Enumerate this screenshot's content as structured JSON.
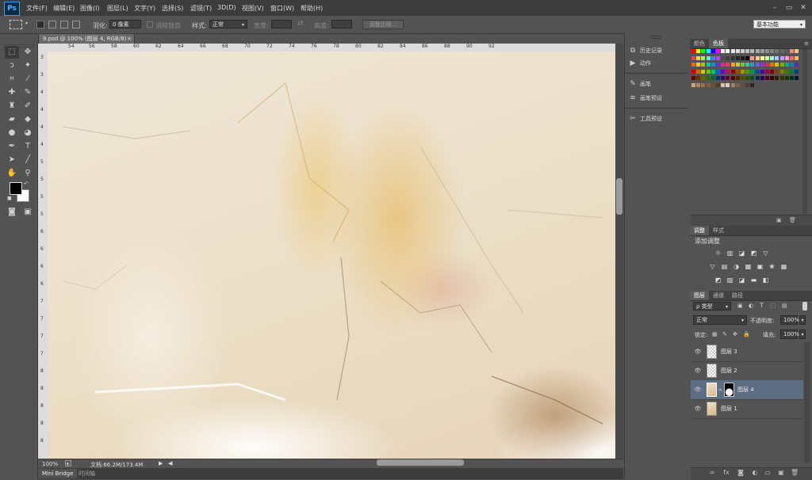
{
  "app": {
    "logo": "Ps"
  },
  "menubar": {
    "items": [
      "文件(F)",
      "编辑(E)",
      "图像(I)",
      "图层(L)",
      "文字(Y)",
      "选择(S)",
      "滤镜(T)",
      "3D(D)",
      "视图(V)",
      "窗口(W)",
      "帮助(H)"
    ],
    "window_controls": {
      "minimize": "–",
      "restore": "▭",
      "close": "✕"
    }
  },
  "options": {
    "feather_label": "羽化:",
    "feather_value": "0 像素",
    "antialias_label": "消除锯齿",
    "style_label": "样式:",
    "style_value": "正常",
    "width_label": "宽度:",
    "height_label": "高度:",
    "refine_edge": "调整边缘...",
    "workspace": "基本功能"
  },
  "document": {
    "tab_title": "9.psd @ 100% (图层 4, RGB/8)",
    "tab_close": "×",
    "hruler": [
      "54",
      "56",
      "58",
      "60",
      "62",
      "64",
      "66",
      "68",
      "70",
      "72",
      "74",
      "76",
      "78",
      "80",
      "82",
      "84",
      "86",
      "88",
      "90",
      "92"
    ],
    "vruler": [
      "3",
      "3",
      "4",
      "4",
      "4",
      "4",
      "5",
      "5",
      "5",
      "5",
      "6",
      "6",
      "6",
      "6",
      "7",
      "7",
      "7",
      "7",
      "8",
      "8",
      "8",
      "8",
      "8"
    ],
    "zoom": "100%",
    "doc_size": "文档:66.2M/173.4M"
  },
  "bottom_tabs": [
    "Mini Bridge",
    "时间轴"
  ],
  "mid_panel": {
    "items": [
      {
        "icon": "history-icon",
        "label": "历史记录"
      },
      {
        "icon": "play-icon",
        "label": "动作"
      },
      {
        "icon": "brush-icon",
        "label": "画笔"
      },
      {
        "icon": "brush-presets-icon",
        "label": "画笔预设"
      },
      {
        "icon": "tool-presets-icon",
        "label": "工具预设"
      }
    ]
  },
  "swatches_panel": {
    "tabs": [
      "颜色",
      "色板"
    ],
    "colors": {
      "row1": [
        "#ff0000",
        "#ffff00",
        "#00ff00",
        "#00ffff",
        "#0000ff",
        "#ff00ff",
        "#ffffff",
        "#f2f2f2",
        "#e6e6e6",
        "#d9d9d9",
        "#cccccc",
        "#bfbfbf",
        "#b3b3b3",
        "#a6a6a6",
        "#999999",
        "#8c8c8c",
        "#808080",
        "#737373",
        "#666666",
        "#595959",
        "#ff8080",
        "#ffbf80"
      ],
      "row2": [
        "#ff4040",
        "#ffd040",
        "#a0ff40",
        "#40ffd0",
        "#4080ff",
        "#c040ff",
        "#4d4d4d",
        "#404040",
        "#333333",
        "#262626",
        "#1a1a1a",
        "#000000",
        "#ff9999",
        "#ffcc99",
        "#ffff99",
        "#ccff99",
        "#99ffcc",
        "#99ccff",
        "#cc99ff",
        "#ff99cc",
        "#ff6666",
        "#ffb366"
      ],
      "row3": [
        "#ff6600",
        "#ffcc00",
        "#99cc00",
        "#00cc99",
        "#0099cc",
        "#6633cc",
        "#cc3399",
        "#ff3366",
        "#ff9933",
        "#cccc33",
        "#66cc33",
        "#33cc99",
        "#3399cc",
        "#6666cc",
        "#9933cc",
        "#cc3366",
        "#e67300",
        "#e6b800",
        "#80b300",
        "#00b386",
        "#0086b3",
        "#5c2eb8"
      ],
      "row4": [
        "#cc0000",
        "#cc6600",
        "#cccc00",
        "#66cc00",
        "#00cc66",
        "#0066cc",
        "#6600cc",
        "#cc0066",
        "#990000",
        "#994d00",
        "#999900",
        "#4d9900",
        "#00994d",
        "#004d99",
        "#4d0099",
        "#99004d",
        "#800000",
        "#804000",
        "#808000",
        "#408000",
        "#008040",
        "#004080"
      ],
      "row5": [
        "#660000",
        "#663300",
        "#666600",
        "#336600",
        "#006633",
        "#003366",
        "#330066",
        "#660033",
        "#4d0000",
        "#4d2600",
        "#4d4d00",
        "#264d00",
        "#004d26",
        "#00264d",
        "#26004d",
        "#4d0026",
        "#330000",
        "#331a00",
        "#333300",
        "#1a3300",
        "#003319",
        "#001a33"
      ],
      "row6": [
        "#c8a882",
        "#b08860",
        "#987050",
        "#806040",
        "#685030",
        "#504020",
        "#d8c0a0",
        "#e0d0b8",
        "#a08060",
        "#786048",
        "#605040",
        "#484038",
        "#302820"
      ]
    }
  },
  "adjust_panel": {
    "tabs": [
      "调整",
      "样式"
    ],
    "title": "添加调整",
    "row1": [
      "brightness-icon",
      "levels-icon",
      "curves-icon",
      "exposure-icon",
      "gradient-icon"
    ],
    "row2": [
      "vibrance-icon",
      "hue-icon",
      "color-balance-icon",
      "bw-icon",
      "photo-filter-icon",
      "channel-mixer-icon",
      "lookup-icon"
    ],
    "row3": [
      "invert-icon",
      "posterize-icon",
      "threshold-icon",
      "gradient-map-icon",
      "selective-color-icon"
    ],
    "glyphs": {
      "row1": [
        "☼",
        "▥",
        "◪",
        "◩",
        "▽"
      ],
      "row2": [
        "▽",
        "▤",
        "◑",
        "▦",
        "▣",
        "❀",
        "▦"
      ],
      "row3": [
        "◩",
        "▨",
        "◪",
        "▬",
        "◧"
      ]
    }
  },
  "layers_panel": {
    "tabs": [
      "图层",
      "通道",
      "路径"
    ],
    "filter_label": "ρ 类型",
    "blend_mode": "正常",
    "opacity_label": "不透明度:",
    "opacity_value": "100%",
    "lock_label": "锁定:",
    "fill_label": "填充:",
    "fill_value": "100%",
    "layers": [
      {
        "name": "图层 3",
        "selected": false
      },
      {
        "name": "图层 2",
        "selected": false
      },
      {
        "name": "图层 4",
        "selected": true
      },
      {
        "name": "图层 1",
        "selected": false
      }
    ]
  },
  "colors": {
    "accent_selected": "#5d6d82",
    "ps_blue": "#4db3ff"
  }
}
